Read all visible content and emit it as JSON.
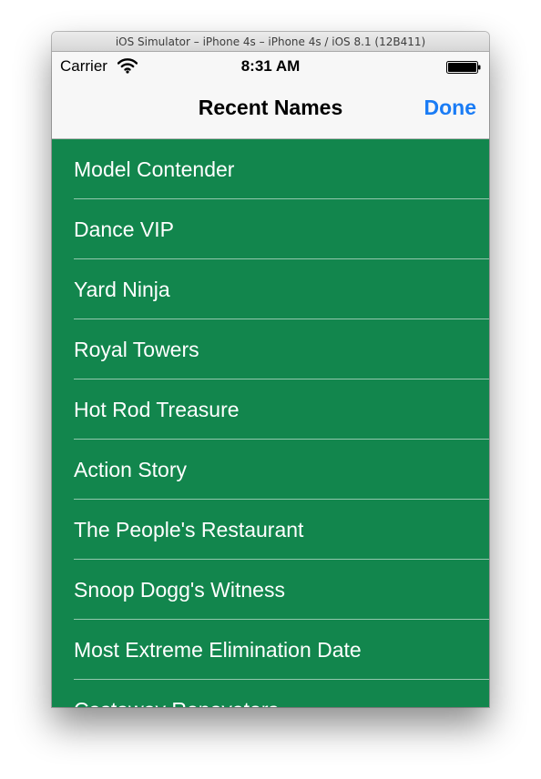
{
  "window": {
    "title": "iOS Simulator – iPhone 4s – iPhone 4s / iOS 8.1 (12B411)"
  },
  "status_bar": {
    "carrier": "Carrier",
    "time": "8:31 AM",
    "icons": [
      "wifi-icon",
      "battery-icon"
    ]
  },
  "nav_bar": {
    "title": "Recent Names",
    "done_label": "Done"
  },
  "list": {
    "items": [
      "Model Contender",
      "Dance VIP",
      "Yard Ninja",
      "Royal Towers",
      "Hot Rod Treasure",
      "Action Story",
      "The People's Restaurant",
      "Snoop Dogg's Witness",
      "Most Extreme Elimination Date",
      "Castaway Renovators"
    ]
  },
  "colors": {
    "list_background": "#12864d",
    "accent": "#1a7cf5",
    "nav_background": "#f7f7f7"
  }
}
